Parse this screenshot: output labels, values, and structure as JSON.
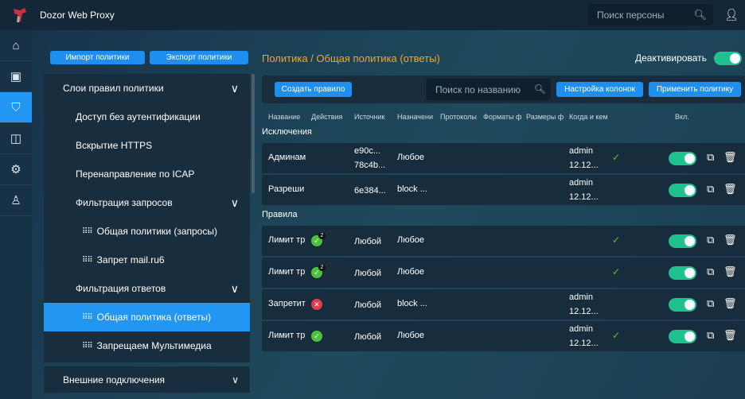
{
  "header": {
    "app_title": "Dozor Web Proxy",
    "person_search_placeholder": "Поиск персоны"
  },
  "rail": [
    "home-icon",
    "id-card-icon",
    "policy-icon",
    "monitor-icon",
    "settings-icon",
    "users-icon"
  ],
  "left": {
    "import_label": "Импорт политики",
    "export_label": "Экспорт политики",
    "items": [
      {
        "label": "Слои правил политики",
        "level": 0,
        "chevron": true
      },
      {
        "label": "Доступ без аутентификации",
        "level": 1
      },
      {
        "label": "Вскрытие HTTPS",
        "level": 1
      },
      {
        "label": "Перенаправление по ICAP",
        "level": 1
      },
      {
        "label": "Фильтрация запросов",
        "level": 1,
        "chevron": true
      },
      {
        "label": "Общая политики (запросы)",
        "level": 2
      },
      {
        "label": "Запрет mail.ru6",
        "level": 2
      },
      {
        "label": "Фильтрация ответов",
        "level": 1,
        "chevron": true
      },
      {
        "label": "Общая политика (ответы)",
        "level": 2,
        "selected": true
      },
      {
        "label": "Запрещаем Мультимедиа",
        "level": 2
      }
    ],
    "external_label": "Внешние подключения"
  },
  "main": {
    "title": "Политика / Общая политика (ответы)",
    "deactivate_label": "Деактивировать",
    "deactivate_on": true,
    "create_label": "Создать правило",
    "search_placeholder": "Поиск по названию",
    "columns_label": "Настройка колонок",
    "apply_label": "Применить политику",
    "columns": [
      "Название",
      "Действия",
      "Источник",
      "Назначени",
      "Протоколы",
      "Форматы ф",
      "Размеры ф",
      "Когда и кем",
      "Вкл."
    ],
    "exceptions_label": "Исключения",
    "rules_label": "Правила",
    "exceptions": [
      {
        "name": "Админам",
        "source": [
          "e90c...",
          "78c4b..."
        ],
        "dest": "Любое",
        "who": [
          "admin",
          "12.12..."
        ],
        "check": true,
        "enabled": true
      },
      {
        "name": "Разреши",
        "source": [
          "6e384..."
        ],
        "dest": "block ...",
        "who": [
          "admin",
          "12.12..."
        ],
        "check": false,
        "enabled": true
      }
    ],
    "rules": [
      {
        "name": "Лимит тр",
        "status": "ok",
        "badge": "2",
        "source": "Любой",
        "dest": "Любое",
        "who": [],
        "check": true,
        "enabled": true
      },
      {
        "name": "Лимит тр",
        "status": "ok",
        "badge": "2",
        "source": "Любой",
        "dest": "Любое",
        "who": [],
        "check": true,
        "enabled": true
      },
      {
        "name": "Запретит",
        "status": "bad",
        "badge": "",
        "source": "Любой",
        "dest": "block ...",
        "who": [
          "admin",
          "12.12..."
        ],
        "check": false,
        "enabled": true
      },
      {
        "name": "Лимит тр",
        "status": "ok",
        "badge": "",
        "source": "Любой",
        "dest": "Любое",
        "who": [
          "admin",
          "12.12..."
        ],
        "check": true,
        "enabled": true
      }
    ]
  }
}
